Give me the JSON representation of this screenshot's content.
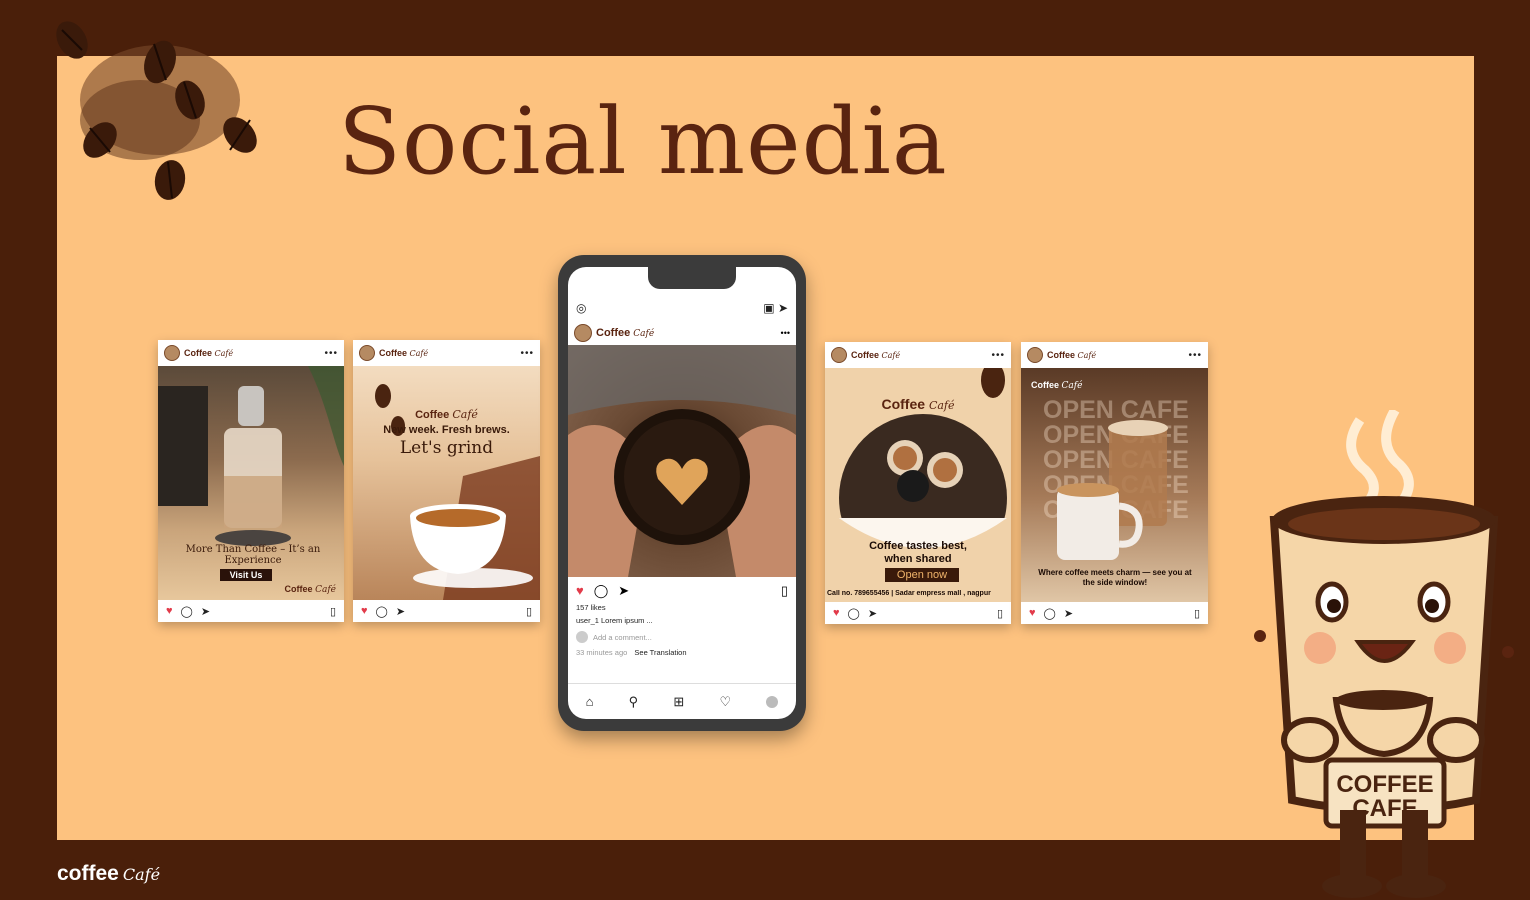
{
  "title": "Social media",
  "brand": {
    "name": "Coffee",
    "suffix": "Café"
  },
  "footer_logo": {
    "name": "coffee",
    "suffix": "Café"
  },
  "posts": [
    {
      "caption": "More Than Coffee – It’s an Experience",
      "button": "Visit Us"
    },
    {
      "line1": "New week. Fresh brews.",
      "line2": "Let's grind"
    },
    {
      "line1": "Coffee tastes best, when shared",
      "button": "Open now",
      "contact": "Call no. 789655456 | Sadar empress mall , nagpur"
    },
    {
      "headline": "OPEN CAFE",
      "caption": "Where coffee meets charm — see you at the side window!"
    }
  ],
  "phone": {
    "likes": "157 likes",
    "caption": "user_1 Lorem ipsum ...",
    "comment_placeholder": "Add a comment...",
    "time": "33 minutes ago",
    "translation": "See Translation"
  },
  "mascot": {
    "label1": "COFFEE",
    "label2": "CAFE"
  },
  "colors": {
    "frame": "#4a1f0a",
    "panel": "#fdc27f",
    "title": "#5a2410"
  }
}
